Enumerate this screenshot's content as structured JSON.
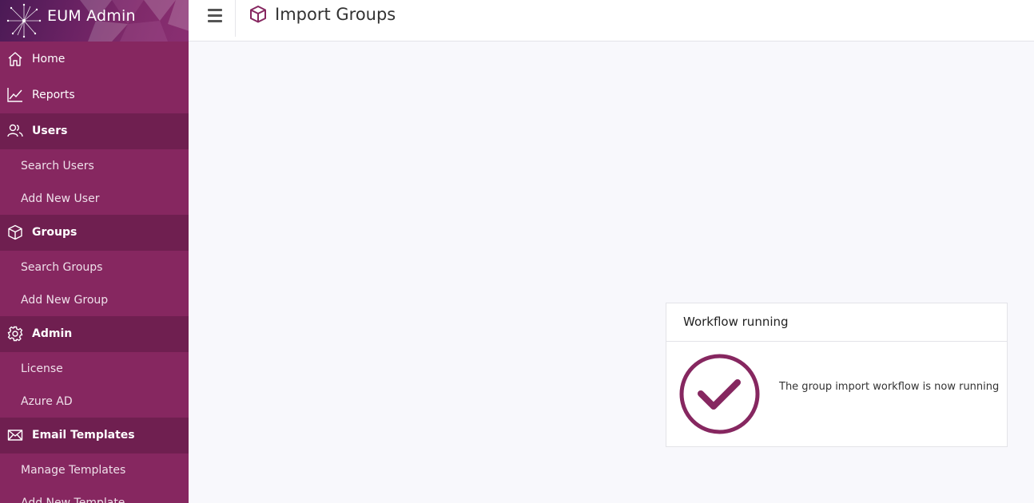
{
  "brand": {
    "title": "EUM Admin",
    "logo_icon": "network-star-logo"
  },
  "topbar": {
    "menu_icon": "hamburger-icon",
    "page_icon": "cube-icon",
    "page_title": "Import Groups"
  },
  "sidebar": {
    "items": [
      {
        "type": "section",
        "label": "Home",
        "icon": "home-icon",
        "active": false
      },
      {
        "type": "section",
        "label": "Reports",
        "icon": "chart-line-icon",
        "active": false
      },
      {
        "type": "section",
        "label": "Users",
        "icon": "users-icon",
        "active": true
      },
      {
        "type": "sub",
        "label": "Search Users"
      },
      {
        "type": "sub",
        "label": "Add New User"
      },
      {
        "type": "section",
        "label": "Groups",
        "icon": "cube-icon",
        "active": true
      },
      {
        "type": "sub",
        "label": "Search Groups"
      },
      {
        "type": "sub",
        "label": "Add New Group"
      },
      {
        "type": "section",
        "label": "Admin",
        "icon": "gear-icon",
        "active": true
      },
      {
        "type": "sub",
        "label": "License"
      },
      {
        "type": "sub",
        "label": "Azure AD"
      },
      {
        "type": "section",
        "label": "Email Templates",
        "icon": "envelope-icon",
        "active": true
      },
      {
        "type": "sub",
        "label": "Manage Templates"
      },
      {
        "type": "sub",
        "label": "Add New Template"
      }
    ]
  },
  "card": {
    "title": "Workflow running",
    "status_icon": "check-circle-icon",
    "message": "The group import workflow is now running"
  },
  "colors": {
    "accent": "#862760",
    "accent_dark": "#6f1f50",
    "background": "#f8f8fc"
  }
}
